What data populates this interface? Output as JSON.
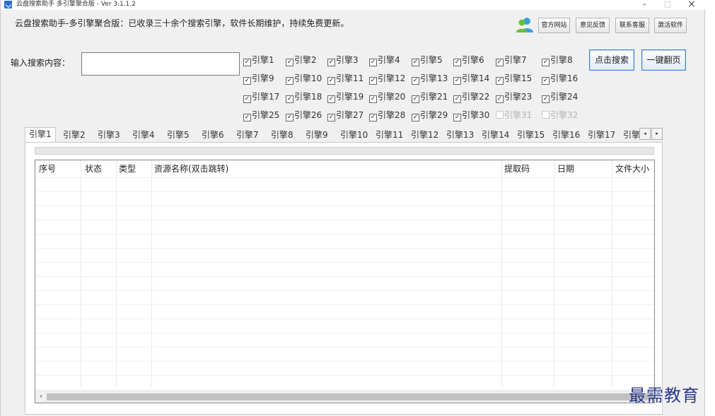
{
  "window": {
    "title": "云盘搜索助手 多引擎聚合版 - Ver 3.1.1.2",
    "minimize": "–",
    "maximize": "□",
    "close": "×"
  },
  "header": {
    "slogan": "云盘搜索助手-多引擎聚合版：已收录三十余个搜索引擎，软件长期维护，持续免费更新。",
    "buttons": {
      "official_site": "官方网站",
      "feedback": "意见反馈",
      "contact_support": "联系客服",
      "activate": "激活软件"
    }
  },
  "search": {
    "label": "输入搜索内容：",
    "value": "",
    "placeholder": "",
    "search_button": "点击搜索",
    "page_button": "一键翻页"
  },
  "engines": [
    {
      "label": "引擎1",
      "checked": true
    },
    {
      "label": "引擎2",
      "checked": true
    },
    {
      "label": "引擎3",
      "checked": true
    },
    {
      "label": "引擎4",
      "checked": true
    },
    {
      "label": "引擎5",
      "checked": true
    },
    {
      "label": "引擎6",
      "checked": true
    },
    {
      "label": "引擎7",
      "checked": true
    },
    {
      "label": "引擎8",
      "checked": true
    },
    {
      "label": "引擎9",
      "checked": true
    },
    {
      "label": "引擎10",
      "checked": true
    },
    {
      "label": "引擎11",
      "checked": true
    },
    {
      "label": "引擎12",
      "checked": true
    },
    {
      "label": "引擎13",
      "checked": true
    },
    {
      "label": "引擎14",
      "checked": true
    },
    {
      "label": "引擎15",
      "checked": true
    },
    {
      "label": "引擎16",
      "checked": true
    },
    {
      "label": "引擎17",
      "checked": true
    },
    {
      "label": "引擎18",
      "checked": true
    },
    {
      "label": "引擎19",
      "checked": true
    },
    {
      "label": "引擎20",
      "checked": true
    },
    {
      "label": "引擎21",
      "checked": true
    },
    {
      "label": "引擎22",
      "checked": true
    },
    {
      "label": "引擎23",
      "checked": true
    },
    {
      "label": "引擎24",
      "checked": true
    },
    {
      "label": "引擎25",
      "checked": true
    },
    {
      "label": "引擎26",
      "checked": true
    },
    {
      "label": "引擎27",
      "checked": true
    },
    {
      "label": "引擎28",
      "checked": true
    },
    {
      "label": "引擎29",
      "checked": true
    },
    {
      "label": "引擎30",
      "checked": true
    },
    {
      "label": "引擎31",
      "checked": false
    },
    {
      "label": "引擎32",
      "checked": false
    }
  ],
  "tabs": [
    {
      "label": "引擎1",
      "active": true
    },
    {
      "label": "引擎2"
    },
    {
      "label": "引擎3"
    },
    {
      "label": "引擎4"
    },
    {
      "label": "引擎5"
    },
    {
      "label": "引擎6"
    },
    {
      "label": "引擎7"
    },
    {
      "label": "引擎8"
    },
    {
      "label": "引擎9"
    },
    {
      "label": "引擎10"
    },
    {
      "label": "引擎11"
    },
    {
      "label": "引擎12"
    },
    {
      "label": "引擎13"
    },
    {
      "label": "引擎14"
    },
    {
      "label": "引擎15"
    },
    {
      "label": "引擎16"
    },
    {
      "label": "引擎17"
    },
    {
      "label": "引擎"
    }
  ],
  "tab_scroll": {
    "left": "◂",
    "right": "▸"
  },
  "results": {
    "columns": [
      "序号",
      "状态",
      "类型",
      "资源名称(双击跳转)",
      "提取码",
      "日期",
      "文件大小"
    ],
    "rows": []
  },
  "scrollbar": {
    "left_arrow": "‹"
  },
  "watermark": "最需教育",
  "colors": {
    "window_bg": "#f0f0f0",
    "accent_border": "#3c7fd3",
    "watermark": "#2a3a8a"
  }
}
